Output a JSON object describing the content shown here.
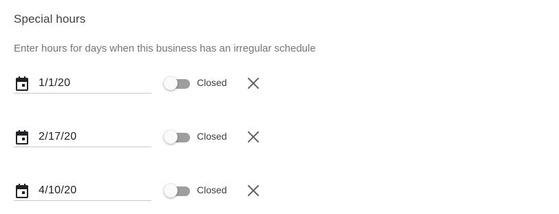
{
  "section": {
    "title": "Special hours",
    "subtitle": "Enter hours for days when this business has an irregular schedule"
  },
  "rows": [
    {
      "date": "1/1/20",
      "status_label": "Closed",
      "toggle_on": false
    },
    {
      "date": "2/17/20",
      "status_label": "Closed",
      "toggle_on": false
    },
    {
      "date": "4/10/20",
      "status_label": "Closed",
      "toggle_on": false
    }
  ],
  "icons": {
    "date": "calendar-icon",
    "remove": "close-icon"
  },
  "colors": {
    "text": "#202124",
    "secondary_text": "#757575",
    "toggle_track": "#9e9e9e",
    "icon": "#5f6368"
  }
}
